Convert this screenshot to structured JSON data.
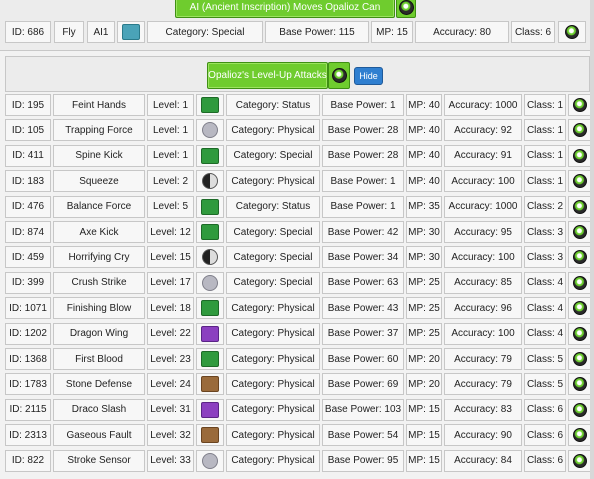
{
  "header": {
    "title": "AI (Ancient Inscription) Moves Opalioz Can Learn",
    "id": "ID: 686",
    "move": "Fly",
    "level": "AI1",
    "category": "Category: Special",
    "base_power": "Base Power: 115",
    "mp": "MP: 15",
    "accuracy": "Accuracy: 80",
    "class": "Class: 6"
  },
  "levelup": {
    "title": "Opalioz's Level-Up Attacks",
    "hide_label": "Hide"
  },
  "moves": [
    {
      "id": "ID: 195",
      "name": "Feint Hands",
      "level": "Level: 1",
      "type": "grass",
      "category": "Category: Status",
      "power": "Base Power: 1",
      "mp": "MP: 40",
      "accuracy": "Accuracy: 1000",
      "class": "Class: 1"
    },
    {
      "id": "ID: 105",
      "name": "Trapping Force",
      "level": "Level: 1",
      "type": "normal",
      "category": "Category: Physical",
      "power": "Base Power: 28",
      "mp": "MP: 40",
      "accuracy": "Accuracy: 92",
      "class": "Class: 1"
    },
    {
      "id": "ID: 411",
      "name": "Spine Kick",
      "level": "Level: 1",
      "type": "grass",
      "category": "Category: Special",
      "power": "Base Power: 28",
      "mp": "MP: 40",
      "accuracy": "Accuracy: 91",
      "class": "Class: 1"
    },
    {
      "id": "ID: 183",
      "name": "Squeeze",
      "level": "Level: 2",
      "type": "yinyang",
      "category": "Category: Physical",
      "power": "Base Power: 1",
      "mp": "MP: 40",
      "accuracy": "Accuracy: 100",
      "class": "Class: 1"
    },
    {
      "id": "ID: 476",
      "name": "Balance Force",
      "level": "Level: 5",
      "type": "grass",
      "category": "Category: Status",
      "power": "Base Power: 1",
      "mp": "MP: 35",
      "accuracy": "Accuracy: 1000",
      "class": "Class: 2"
    },
    {
      "id": "ID: 874",
      "name": "Axe Kick",
      "level": "Level: 12",
      "type": "grass",
      "category": "Category: Special",
      "power": "Base Power: 42",
      "mp": "MP: 30",
      "accuracy": "Accuracy: 95",
      "class": "Class: 3"
    },
    {
      "id": "ID: 459",
      "name": "Horrifying Cry",
      "level": "Level: 15",
      "type": "yinyang",
      "category": "Category: Special",
      "power": "Base Power: 34",
      "mp": "MP: 30",
      "accuracy": "Accuracy: 100",
      "class": "Class: 3"
    },
    {
      "id": "ID: 399",
      "name": "Crush Strike",
      "level": "Level: 17",
      "type": "normal",
      "category": "Category: Special",
      "power": "Base Power: 63",
      "mp": "MP: 25",
      "accuracy": "Accuracy: 85",
      "class": "Class: 4"
    },
    {
      "id": "ID: 1071",
      "name": "Finishing Blow",
      "level": "Level: 18",
      "type": "grass",
      "category": "Category: Physical",
      "power": "Base Power: 43",
      "mp": "MP: 25",
      "accuracy": "Accuracy: 96",
      "class": "Class: 4"
    },
    {
      "id": "ID: 1202",
      "name": "Dragon Wing",
      "level": "Level: 22",
      "type": "dragon",
      "category": "Category: Physical",
      "power": "Base Power: 37",
      "mp": "MP: 25",
      "accuracy": "Accuracy: 100",
      "class": "Class: 4"
    },
    {
      "id": "ID: 1368",
      "name": "First Blood",
      "level": "Level: 23",
      "type": "grass",
      "category": "Category: Physical",
      "power": "Base Power: 60",
      "mp": "MP: 20",
      "accuracy": "Accuracy: 79",
      "class": "Class: 5"
    },
    {
      "id": "ID: 1783",
      "name": "Stone Defense",
      "level": "Level: 24",
      "type": "ground",
      "category": "Category: Physical",
      "power": "Base Power: 69",
      "mp": "MP: 20",
      "accuracy": "Accuracy: 79",
      "class": "Class: 5"
    },
    {
      "id": "ID: 2115",
      "name": "Draco Slash",
      "level": "Level: 31",
      "type": "dragon",
      "category": "Category: Physical",
      "power": "Base Power: 103",
      "mp": "MP: 15",
      "accuracy": "Accuracy: 83",
      "class": "Class: 6"
    },
    {
      "id": "ID: 2313",
      "name": "Gaseous Fault",
      "level": "Level: 32",
      "type": "ground",
      "category": "Category: Physical",
      "power": "Base Power: 54",
      "mp": "MP: 15",
      "accuracy": "Accuracy: 90",
      "class": "Class: 6"
    },
    {
      "id": "ID: 822",
      "name": "Stroke Sensor",
      "level": "Level: 33",
      "type": "normal",
      "category": "Category: Physical",
      "power": "Base Power: 95",
      "mp": "MP: 15",
      "accuracy": "Accuracy: 84",
      "class": "Class: 6"
    }
  ]
}
